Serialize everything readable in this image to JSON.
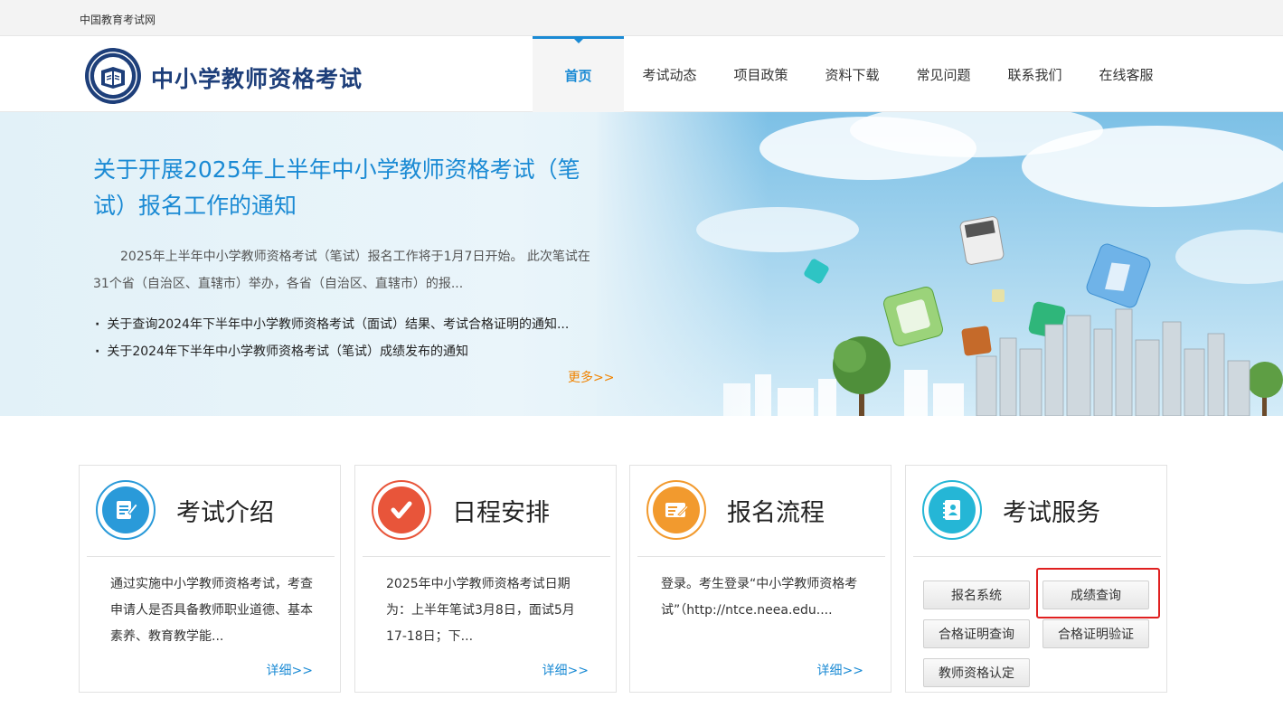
{
  "topbar": {
    "site_name": "中国教育考试网"
  },
  "header": {
    "brand": "中小学教师资格考试",
    "nav": [
      "首页",
      "考试动态",
      "项目政策",
      "资料下载",
      "常见问题",
      "联系我们",
      "在线客服"
    ]
  },
  "banner": {
    "title": "关于开展2025年上半年中小学教师资格考试（笔试）报名工作的通知",
    "summary": "2025年上半年中小学教师资格考试（笔试）报名工作将于1月7日开始。 此次笔试在31个省（自治区、直辖市）举办，各省（自治区、直辖市）的报...",
    "news": [
      "关于查询2024年下半年中小学教师资格考试（面试）结果、考试合格证明的通知...",
      "关于2024年下半年中小学教师资格考试（笔试）成绩发布的通知"
    ],
    "more": "更多>>"
  },
  "cards": [
    {
      "title": "考试介绍",
      "body": "通过实施中小学教师资格考试，考查申请人是否具备教师职业道德、基本素养、教育教学能...",
      "detail": "详细>>"
    },
    {
      "title": "日程安排",
      "body": "2025年中小学教师资格考试日期为：上半年笔试3月8日，面试5月17-18日；下...",
      "detail": "详细>>"
    },
    {
      "title": "报名流程",
      "body": "登录。考生登录“中小学教师资格考试”（http://ntce.neea.edu....",
      "detail": "详细>>"
    },
    {
      "title": "考试服务",
      "buttons": [
        "报名系统",
        "成绩查询",
        "合格证明查询",
        "合格证明验证",
        "教师资格认定"
      ]
    }
  ],
  "colors": {
    "accent": "#1a8ad4",
    "brand": "#1e3f7a",
    "more": "#f08300",
    "highlight": "#e02020"
  }
}
